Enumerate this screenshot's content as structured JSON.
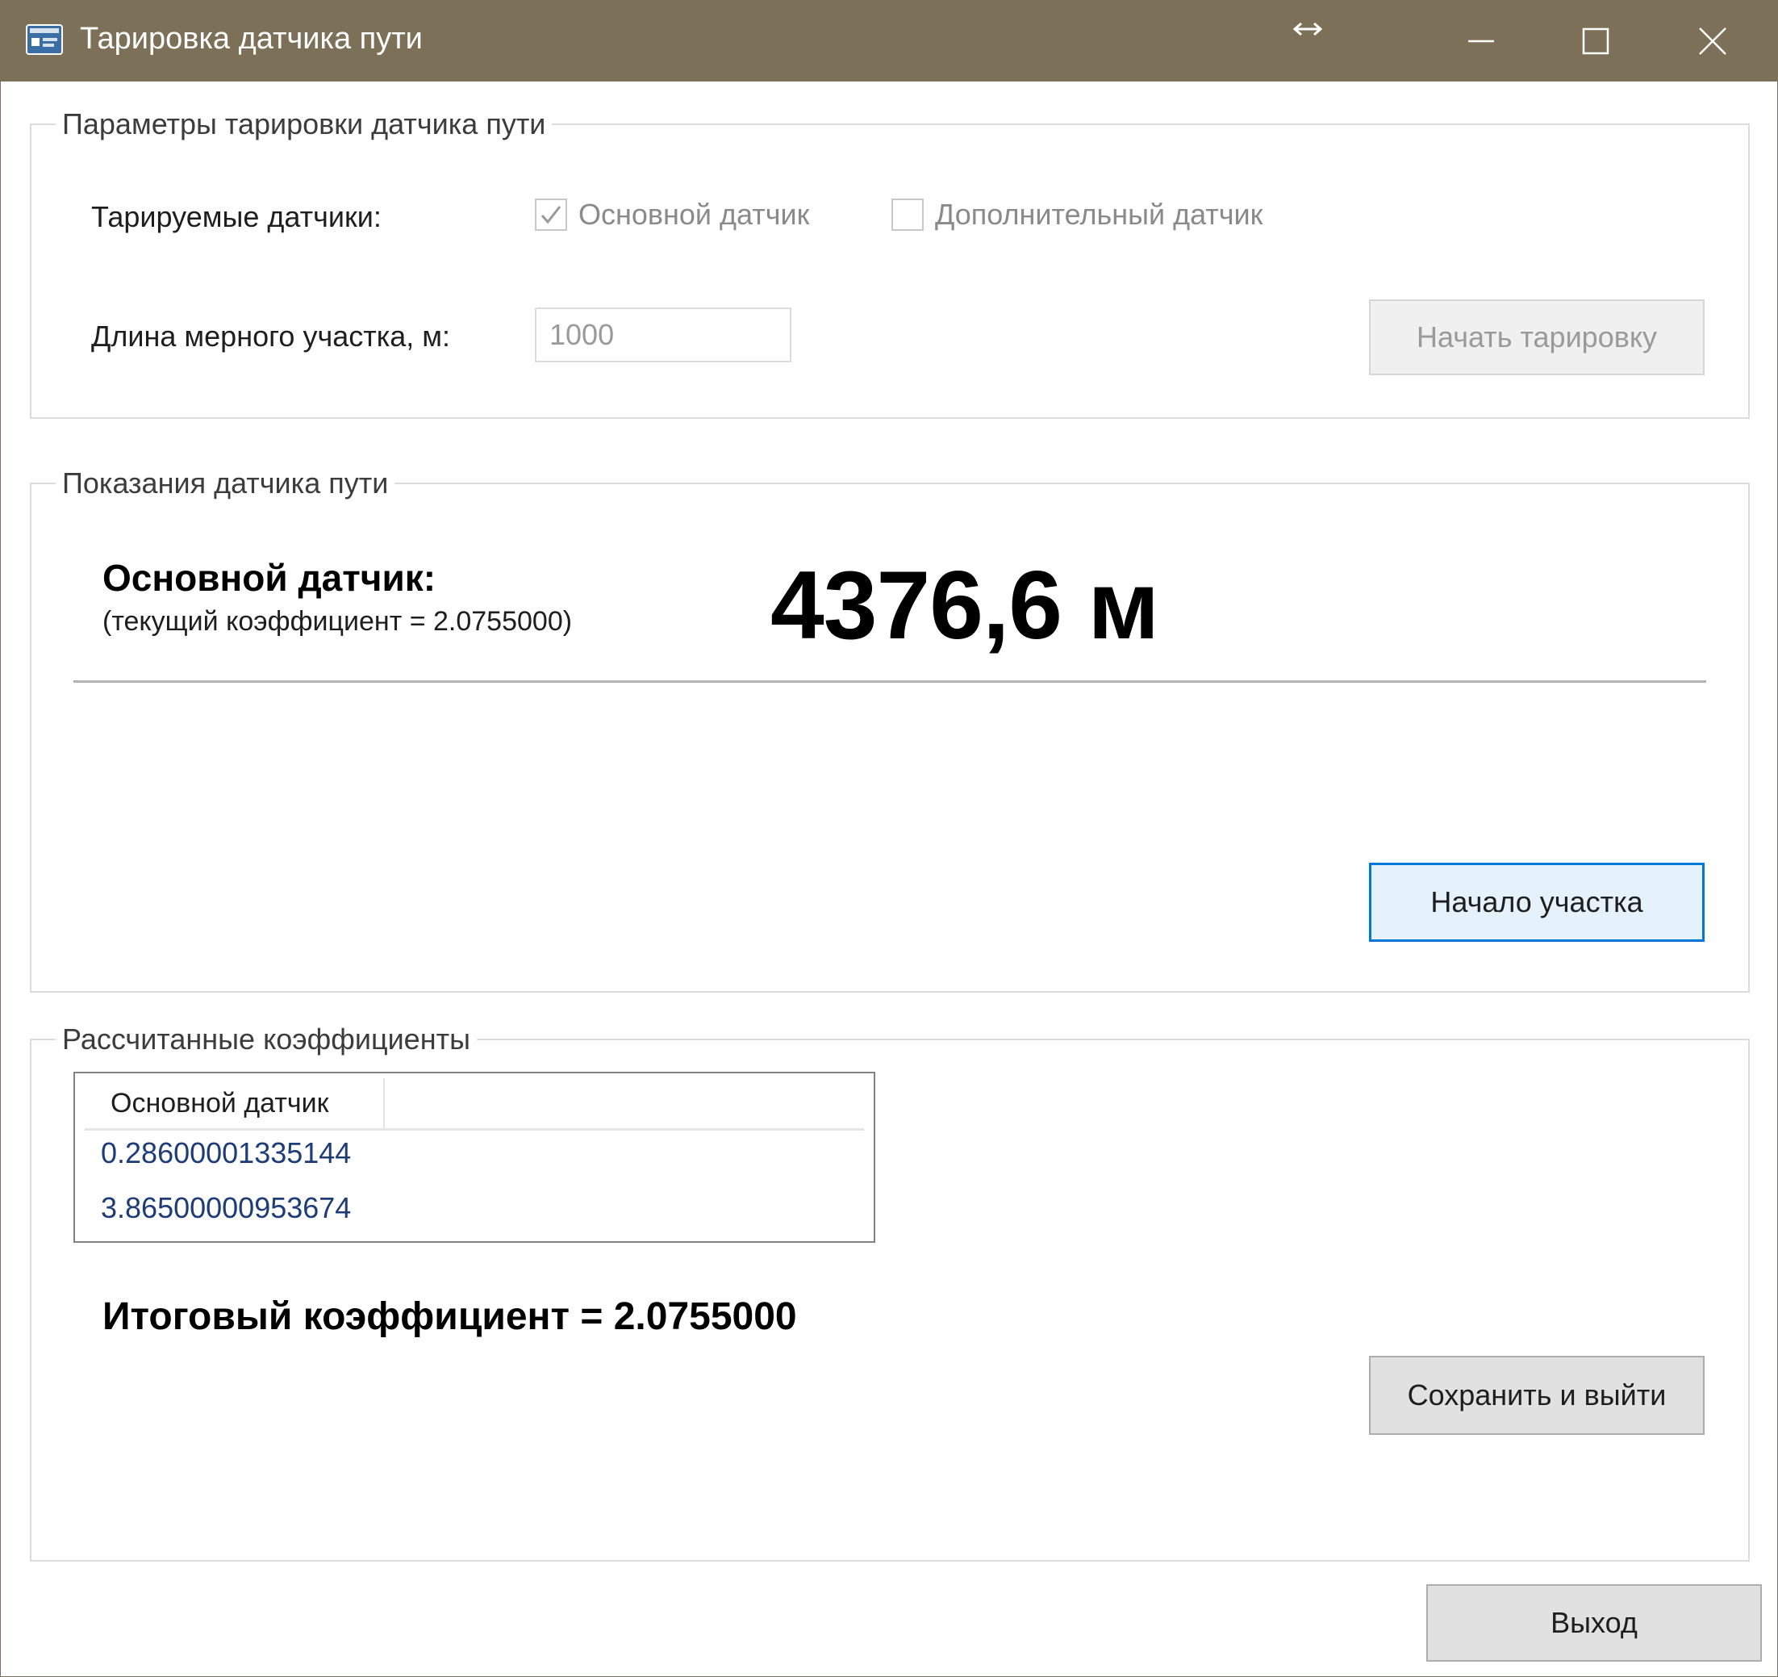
{
  "window": {
    "title": "Тарировка датчика пути"
  },
  "titlebar_icons": [
    "app-icon",
    "resize-icon",
    "minimize-icon",
    "maximize-icon",
    "close-icon"
  ],
  "params": {
    "legend": "Параметры тарировки датчика пути",
    "sensors_label": "Тарируемые датчики:",
    "main_sensor_checkbox": {
      "label": "Основной датчик",
      "checked": true,
      "enabled": false
    },
    "extra_sensor_checkbox": {
      "label": "Дополнительный датчик",
      "checked": false,
      "enabled": false
    },
    "length_label": "Длина мерного участка, м:",
    "length_value": "1000",
    "start_button": "Начать тарировку"
  },
  "readings": {
    "legend": "Показания датчика пути",
    "sensor_name": "Основной датчик:",
    "coefficient_text": "(текущий коэффициент = 2.0755000)",
    "value": "4376,6 м",
    "section_start_button": "Начало участка"
  },
  "computed": {
    "legend": "Рассчитанные коэффициенты",
    "column_header": "Основной датчик",
    "rows": [
      "0.28600001335144",
      "3.86500000953674"
    ],
    "final_coefficient": "Итоговый коэффициент = 2.0755000",
    "save_button": "Сохранить и выйти"
  },
  "exit_button": "Выход",
  "colors": {
    "titlebar": "#7c7058",
    "focus_border": "#0078d7",
    "list_text": "#1e3c78"
  }
}
